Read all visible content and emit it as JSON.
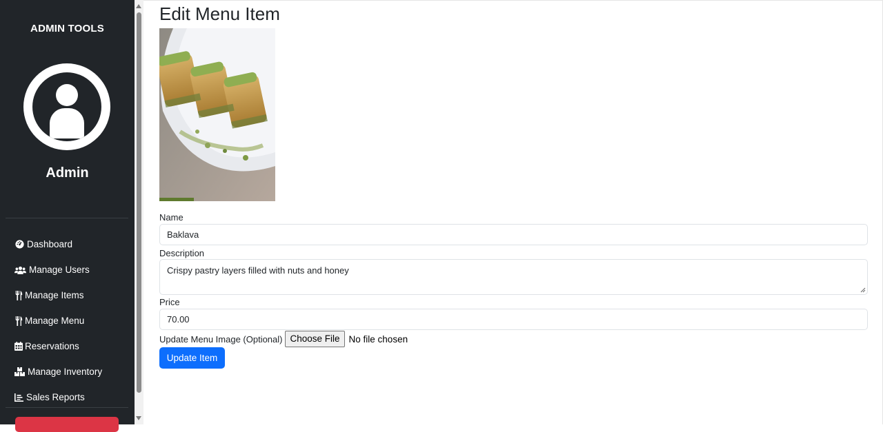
{
  "sidebar": {
    "brand": "ADMIN TOOLS",
    "admin_name": "Admin",
    "items": [
      {
        "label": "Dashboard",
        "icon": "dashboard-icon"
      },
      {
        "label": "Manage Users",
        "icon": "users-icon"
      },
      {
        "label": "Manage Items",
        "icon": "utensils-icon"
      },
      {
        "label": "Manage Menu",
        "icon": "utensils-icon"
      },
      {
        "label": "Reservations",
        "icon": "calendar-icon"
      },
      {
        "label": "Manage Inventory",
        "icon": "boxes-icon"
      },
      {
        "label": "Sales Reports",
        "icon": "chart-icon"
      }
    ]
  },
  "main": {
    "title": "Edit Menu Item",
    "image_alt": "Baklava photo",
    "name_label": "Name",
    "name_value": "Baklava",
    "description_label": "Description",
    "description_value": "Crispy pastry layers filled with nuts and honey",
    "price_label": "Price",
    "price_value": "70.00",
    "image_label": "Update Menu Image (Optional)",
    "file_button": "Choose File",
    "file_status": "No file chosen",
    "submit_label": "Update Item"
  },
  "colors": {
    "sidebar_bg": "#212529",
    "primary": "#0d6efd",
    "danger": "#dc3545"
  }
}
